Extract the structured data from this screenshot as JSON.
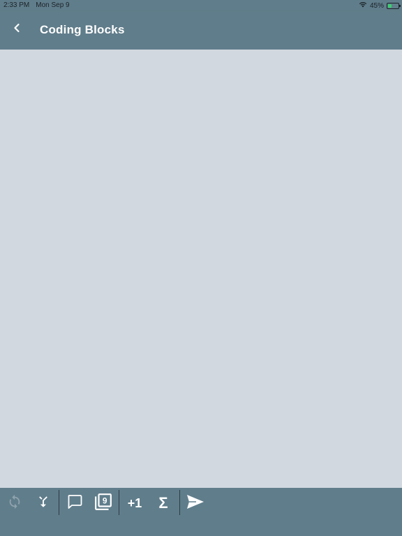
{
  "status_bar": {
    "time": "2:33 PM",
    "date": "Mon Sep 9",
    "battery": "45%",
    "wifi_icon": "wifi-icon",
    "battery_icon": "battery-charging-icon",
    "battery_level": 0.45
  },
  "app_bar": {
    "title": "Coding Blocks",
    "back_icon": "chevron-left-icon",
    "color": "#607d8b"
  },
  "toolbar": {
    "items": [
      {
        "icon": "refresh-icon",
        "enabled": false
      },
      {
        "icon": "merge-arrows-icon",
        "enabled": true
      },
      {
        "icon": "comment-icon",
        "enabled": true
      },
      {
        "icon": "filter-9-icon",
        "label": "9",
        "enabled": true
      },
      {
        "icon": "plus-one-icon",
        "label": "+1",
        "enabled": true
      },
      {
        "icon": "sigma-icon",
        "label": "Σ",
        "enabled": true
      },
      {
        "icon": "send-icon",
        "enabled": true
      }
    ]
  },
  "colors": {
    "primary": "#607d8b",
    "background": "#d1d8df",
    "disabled_icon": "#8fa3ad"
  }
}
